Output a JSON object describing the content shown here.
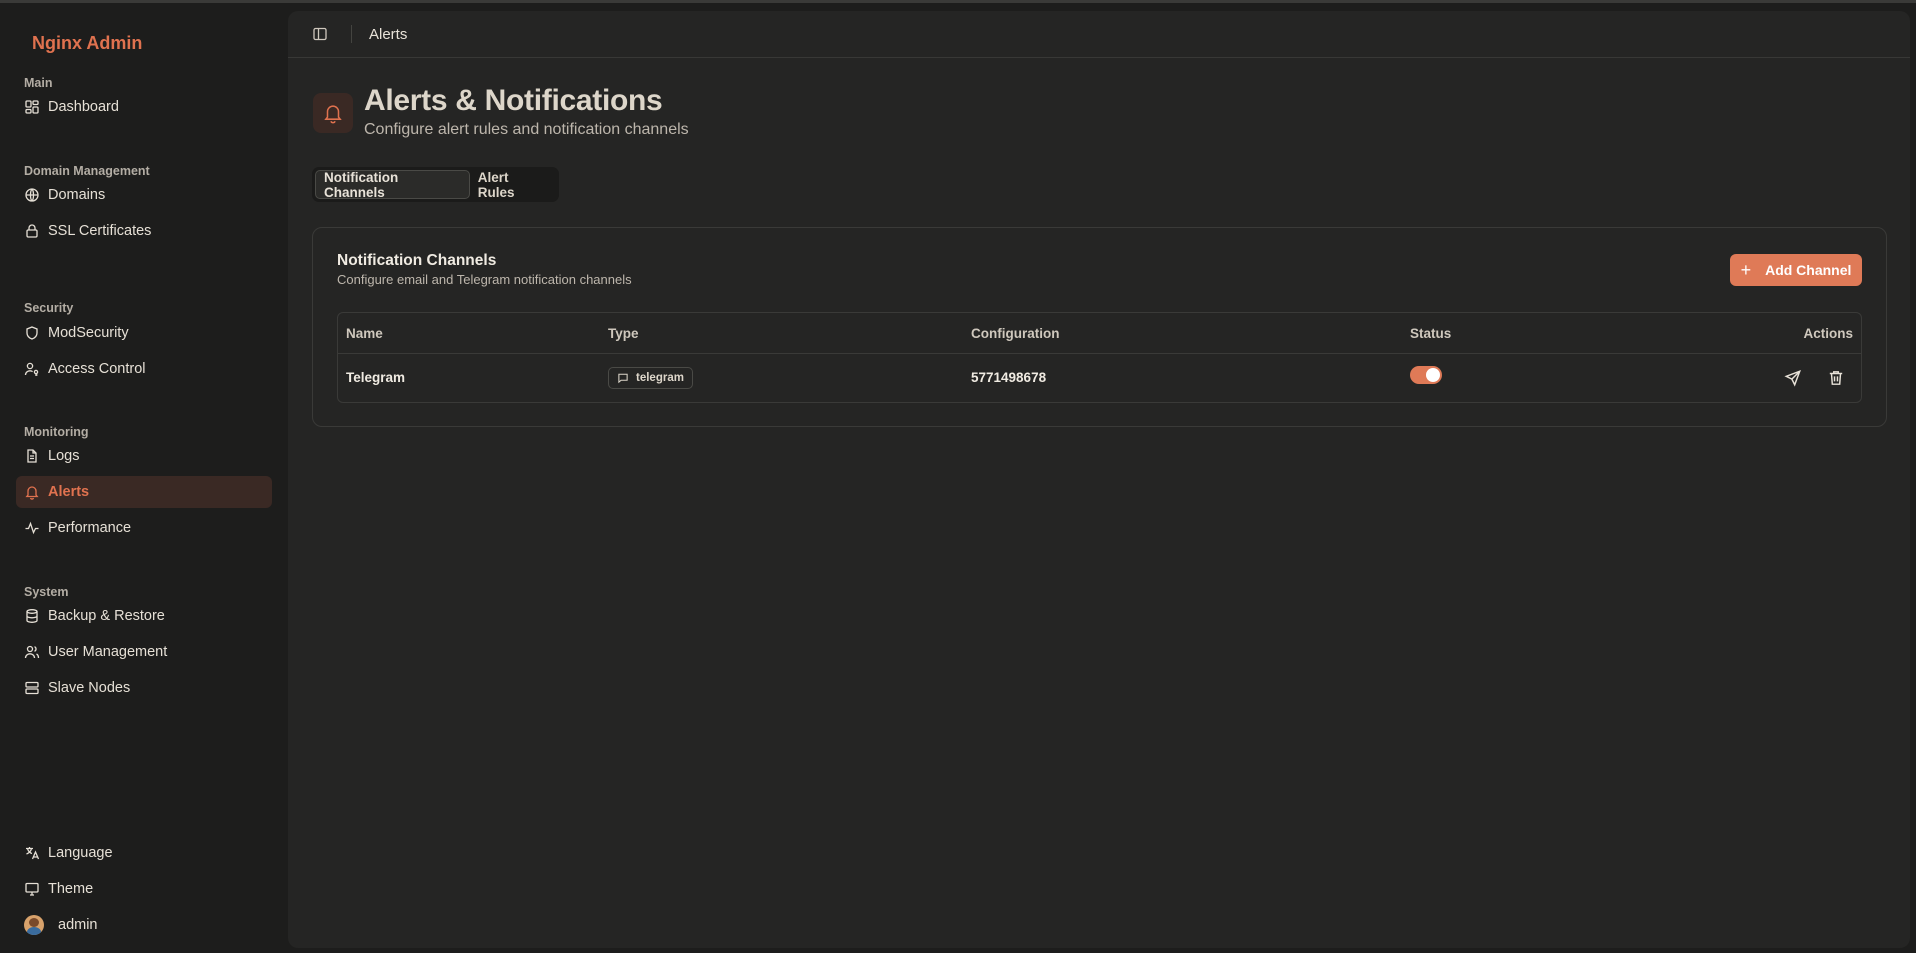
{
  "brand": "Nginx Admin",
  "sidebar": {
    "groups": [
      {
        "label": "Main"
      },
      {
        "label": "Domain Management"
      },
      {
        "label": "Security"
      },
      {
        "label": "Monitoring"
      },
      {
        "label": "System"
      }
    ],
    "items": {
      "dashboard": "Dashboard",
      "domains": "Domains",
      "ssl": "SSL Certificates",
      "modsecurity": "ModSecurity",
      "access_control": "Access Control",
      "logs": "Logs",
      "alerts": "Alerts",
      "performance": "Performance",
      "backup": "Backup & Restore",
      "users": "User Management",
      "slave_nodes": "Slave Nodes"
    },
    "footer": {
      "language": "Language",
      "theme": "Theme",
      "user": "admin"
    }
  },
  "topbar": {
    "breadcrumb": "Alerts"
  },
  "header": {
    "title": "Alerts & Notifications",
    "subtitle": "Configure alert rules and notification channels"
  },
  "tabs": [
    {
      "label": "Notification Channels",
      "active": true
    },
    {
      "label": "Alert Rules",
      "active": false
    }
  ],
  "card": {
    "title": "Notification Channels",
    "subtitle": "Configure email and Telegram notification channels",
    "add_button": "Add Channel",
    "columns": [
      "Name",
      "Type",
      "Configuration",
      "Status",
      "Actions"
    ],
    "rows": [
      {
        "name": "Telegram",
        "type": "telegram",
        "configuration": "5771498678",
        "enabled": true
      }
    ]
  },
  "colors": {
    "accent": "#df7a57",
    "background": "#1d1d1c",
    "panel": "#252524"
  }
}
